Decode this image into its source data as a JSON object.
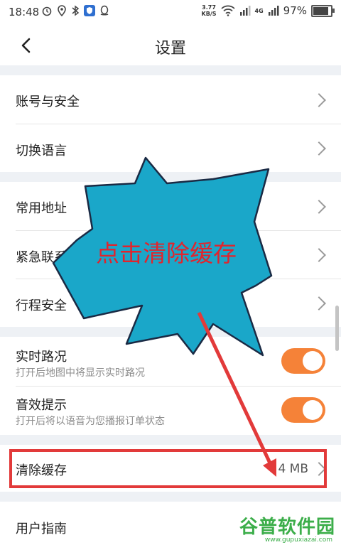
{
  "status_bar": {
    "time": "18:48",
    "net_speed_value": "3.77",
    "net_speed_unit": "KB/S",
    "battery_text": "97%",
    "battery_level": 0.97,
    "signal_4g": "4G",
    "icons": [
      "alarm-icon",
      "location-icon",
      "bluetooth-icon",
      "shield-app-icon",
      "qq-icon",
      "wifi-icon",
      "signal-icon"
    ]
  },
  "header": {
    "title": "设置",
    "back_icon": "chevron-left-icon"
  },
  "sections": {
    "account": {
      "label": "账号与安全"
    },
    "language": {
      "label": "切换语言"
    },
    "address": {
      "label": "常用地址"
    },
    "emergency": {
      "label": "紧急联系"
    },
    "trip_safety": {
      "label": "行程安全"
    },
    "traffic": {
      "label": "实时路况",
      "sub": "打开后地图中将显示实时路况",
      "enabled": true
    },
    "sound": {
      "label": "音效提示",
      "sub": "打开后将以语音为您播报订单状态",
      "enabled": true
    },
    "cache": {
      "label": "清除缓存",
      "value": "4 MB"
    },
    "guide": {
      "label": "用户指南"
    }
  },
  "annotation": {
    "text": "点击清除缓存",
    "star_color": "#1aa7c9",
    "text_color": "#e0252d",
    "highlight_color": "#e23a3a"
  },
  "watermark": {
    "main": "谷普软件园",
    "url": "www.gupuxiazai.com"
  },
  "colors": {
    "accent_toggle": "#f58238",
    "section_gap": "#eef1f5"
  }
}
